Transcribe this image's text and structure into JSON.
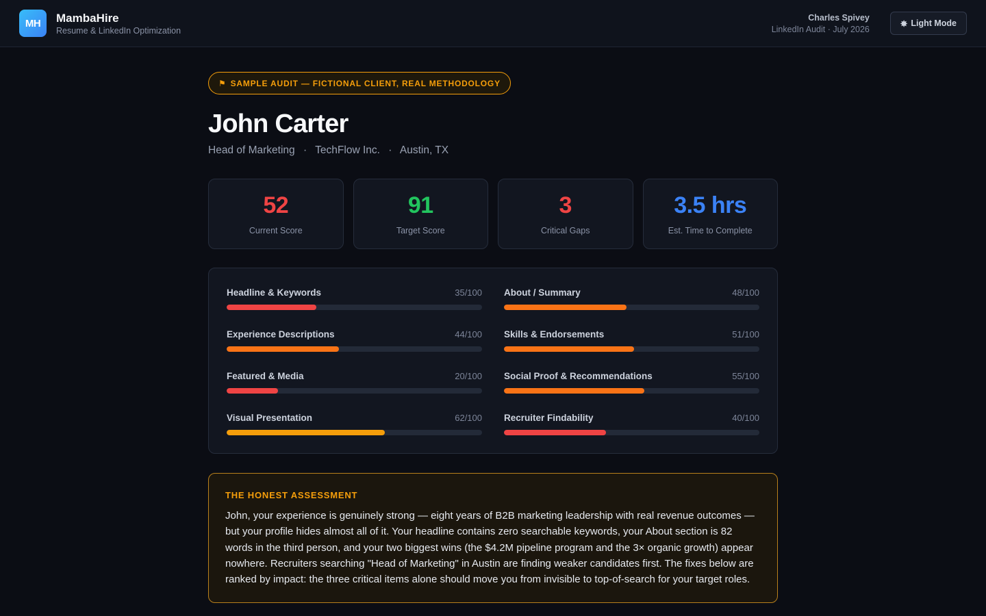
{
  "header": {
    "logo_text": "MH",
    "brand_name": "MambaHire",
    "brand_tagline": "Resume & LinkedIn Optimization",
    "client_name": "Charles Spivey",
    "audit_meta": "LinkedIn Audit · July 2026",
    "mode_button_icon": "✸",
    "mode_button_label": "Light Mode"
  },
  "profile": {
    "sample_icon": "⚑",
    "sample_label": "SAMPLE AUDIT — FICTIONAL CLIENT, REAL METHODOLOGY",
    "name": "John Carter",
    "role": "Head of Marketing",
    "company": "TechFlow Inc.",
    "location": "Austin, TX",
    "separator": "·"
  },
  "stats": [
    {
      "value": "52",
      "label": "Current Score",
      "color": "#ef4444"
    },
    {
      "value": "91",
      "label": "Target Score",
      "color": "#22c55e"
    },
    {
      "value": "3",
      "label": "Critical Gaps",
      "color": "#ef4444"
    },
    {
      "value": "3.5 hrs",
      "label": "Est. Time to Complete",
      "color": "#3b82f6"
    }
  ],
  "scores": [
    {
      "label": "Headline & Keywords",
      "display": "35/100",
      "value": 35,
      "color": "#ef4444"
    },
    {
      "label": "About / Summary",
      "display": "48/100",
      "value": 48,
      "color": "#f97316"
    },
    {
      "label": "Experience Descriptions",
      "display": "44/100",
      "value": 44,
      "color": "#f97316"
    },
    {
      "label": "Skills & Endorsements",
      "display": "51/100",
      "value": 51,
      "color": "#f97316"
    },
    {
      "label": "Featured & Media",
      "display": "20/100",
      "value": 20,
      "color": "#ef4444"
    },
    {
      "label": "Social Proof & Recommendations",
      "display": "55/100",
      "value": 55,
      "color": "#f97316"
    },
    {
      "label": "Visual Presentation",
      "display": "62/100",
      "value": 62,
      "color": "#f59e0b"
    },
    {
      "label": "Recruiter Findability",
      "display": "40/100",
      "value": 40,
      "color": "#ef4444"
    }
  ],
  "assessment": {
    "title": "THE HONEST ASSESSMENT",
    "text": "John, your experience is genuinely strong — eight years of B2B marketing leadership with real revenue outcomes — but your profile hides almost all of it. Your headline contains zero searchable keywords, your About section is 82 words in the third person, and your two biggest wins (the $4.2M pipeline program and the 3× organic growth) appear nowhere. Recruiters searching \"Head of Marketing\" in Austin are finding weaker candidates first. The fixes below are ranked by impact: the three critical items alone should move you from invisible to top-of-search for your target roles."
  }
}
